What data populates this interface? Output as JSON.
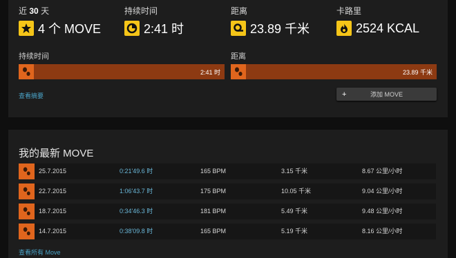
{
  "summary": {
    "period_prefix": "近",
    "period_number": "30",
    "period_suffix": "天",
    "moves_value": "4 个 MOVE",
    "duration_label": "持续时间",
    "duration_value": "2:41 时",
    "distance_label": "距离",
    "distance_value": "23.89 千米",
    "calories_label": "卡路里",
    "calories_value": "2524 KCAL",
    "icons": [
      "star-icon",
      "clock-icon",
      "distance-icon",
      "flame-icon",
      "shoe-icon"
    ],
    "accent_color": "#f5c518",
    "bar_color": "#8d3a12",
    "bar_icon_color": "#e0651d"
  },
  "bars": {
    "duration_label": "持续时间",
    "duration_value": "2:41 时",
    "distance_label": "距离",
    "distance_value": "23.89 千米"
  },
  "actions": {
    "view_summary": "查看摘要",
    "add_move": "添加 MOVE",
    "view_all": "查看所有 Move"
  },
  "latest": {
    "title": "我的最新 MOVE",
    "rows": [
      {
        "date": "25.7.2015",
        "duration": "0:21'49.6 时",
        "bpm": "165 BPM",
        "distance": "3.15 千米",
        "speed": "8.67 公里/小时"
      },
      {
        "date": "22.7.2015",
        "duration": "1:06'43.7 时",
        "bpm": "175 BPM",
        "distance": "10.05 千米",
        "speed": "9.04 公里/小时"
      },
      {
        "date": "18.7.2015",
        "duration": "0:34'46.3 时",
        "bpm": "181 BPM",
        "distance": "5.49 千米",
        "speed": "9.48 公里/小时"
      },
      {
        "date": "14.7.2015",
        "duration": "0:38'09.8 时",
        "bpm": "165 BPM",
        "distance": "5.19 千米",
        "speed": "8.16 公里/小时"
      }
    ]
  }
}
